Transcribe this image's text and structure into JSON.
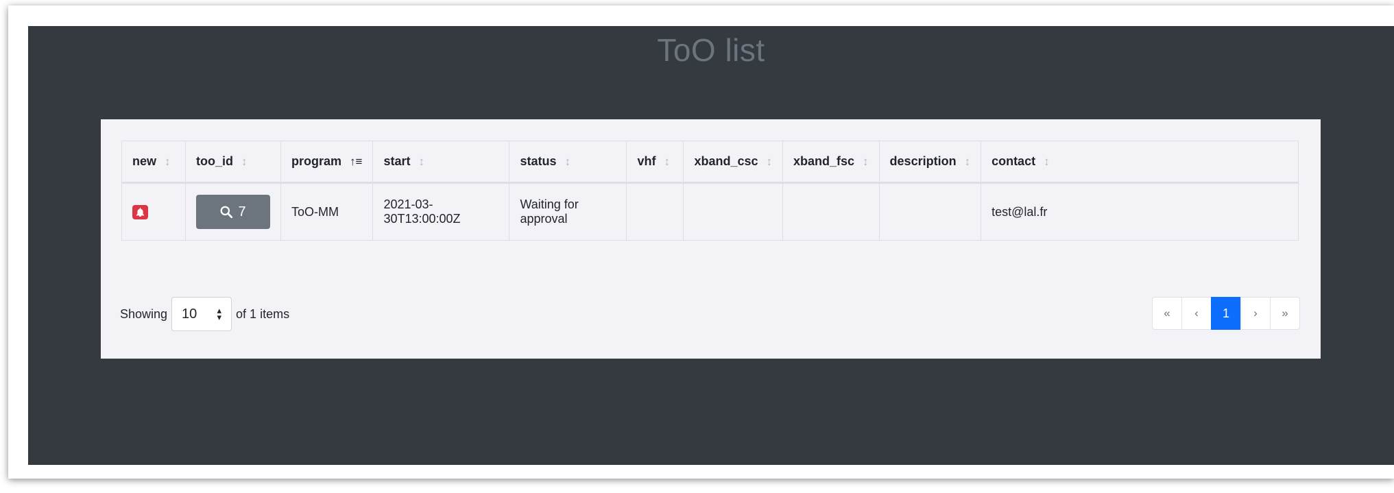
{
  "app": {
    "title": "ToO list"
  },
  "table": {
    "columns": [
      {
        "key": "new",
        "label": "new",
        "sort": "none"
      },
      {
        "key": "too_id",
        "label": "too_id",
        "sort": "none"
      },
      {
        "key": "program",
        "label": "program",
        "sort": "asc"
      },
      {
        "key": "start",
        "label": "start",
        "sort": "none"
      },
      {
        "key": "status",
        "label": "status",
        "sort": "none"
      },
      {
        "key": "vhf",
        "label": "vhf",
        "sort": "none"
      },
      {
        "key": "xband_csc",
        "label": "xband_csc",
        "sort": "none"
      },
      {
        "key": "xband_fsc",
        "label": "xband_fsc",
        "sort": "none"
      },
      {
        "key": "description",
        "label": "description",
        "sort": "none"
      },
      {
        "key": "contact",
        "label": "contact",
        "sort": "none"
      }
    ],
    "rows": [
      {
        "new_icon": "bell-icon",
        "too_id": "7",
        "program": "ToO-MM",
        "start": "2021-03-30T13:00:00Z",
        "status": "Waiting for approval",
        "vhf": "",
        "xband_csc": "",
        "xband_fsc": "",
        "description": "",
        "contact": "test@lal.fr"
      }
    ]
  },
  "footer": {
    "showing_label": "Showing",
    "page_size": "10",
    "of_items": "of 1 items"
  },
  "pagination": {
    "first": "«",
    "prev": "‹",
    "current": "1",
    "next": "›",
    "last": "»"
  },
  "colors": {
    "background": "#343a40",
    "panel": "#f3f3f7",
    "badge_red": "#dc3545",
    "button_grey": "#6c757d",
    "active_page": "#0d6efd"
  }
}
